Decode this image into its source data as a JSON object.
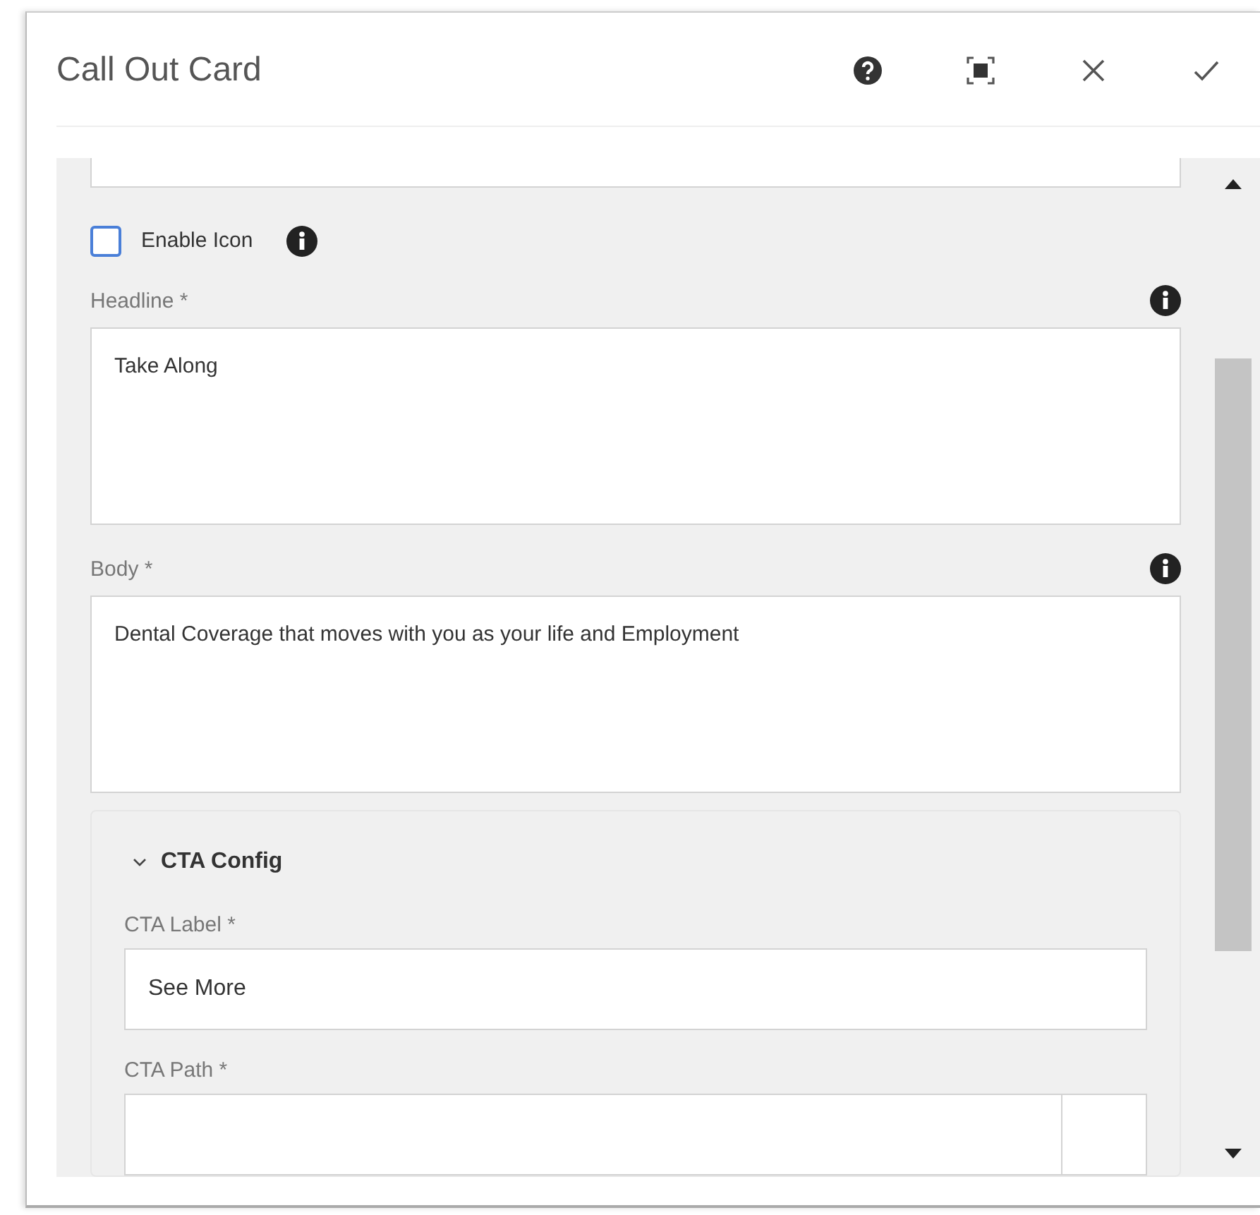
{
  "dialog": {
    "title": "Call Out Card"
  },
  "enable_icon": {
    "label": "Enable Icon",
    "checked": false
  },
  "fields": [
    {
      "label": "Headline *",
      "value": "Take Along"
    },
    {
      "label": "Body *",
      "value": "Dental Coverage that moves with you as your life and Employment"
    }
  ],
  "cta_section": {
    "title": "CTA Config",
    "expanded": true,
    "label_field": {
      "label": "CTA Label *",
      "value": "See More"
    },
    "path_field": {
      "label": "CTA Path *"
    }
  }
}
